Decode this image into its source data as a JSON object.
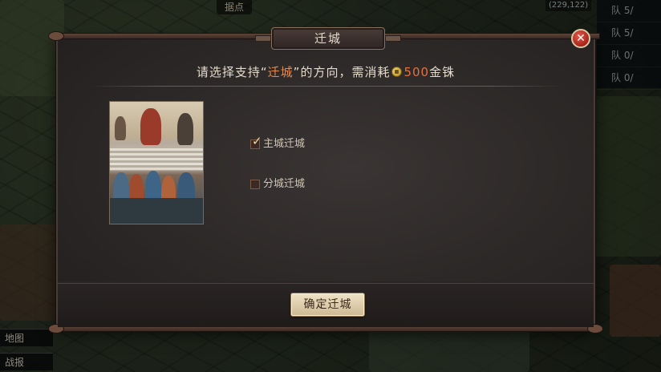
{
  "map": {
    "top_label": "据点",
    "coord": "(229,122)",
    "right_list": [
      "队 5/",
      "队 5/",
      "队 0/",
      "队 0/"
    ],
    "bottom_buttons": [
      "地图",
      "战报"
    ]
  },
  "dialog": {
    "title": "迁城",
    "close_icon": "close-x",
    "prompt_before": "请选择支持“",
    "prompt_highlight": "迁城",
    "prompt_after": "”的方向，需消耗",
    "currency_icon": "gold-coin",
    "cost": "500",
    "currency_name": "金铢",
    "options": [
      {
        "label": "主城迁城",
        "checked": true
      },
      {
        "label": "分城迁城",
        "checked": false
      }
    ],
    "confirm_label": "确定迁城"
  },
  "colors": {
    "highlight": "#e88a4c",
    "cost": "#e8703c",
    "close": "#c0392b"
  }
}
